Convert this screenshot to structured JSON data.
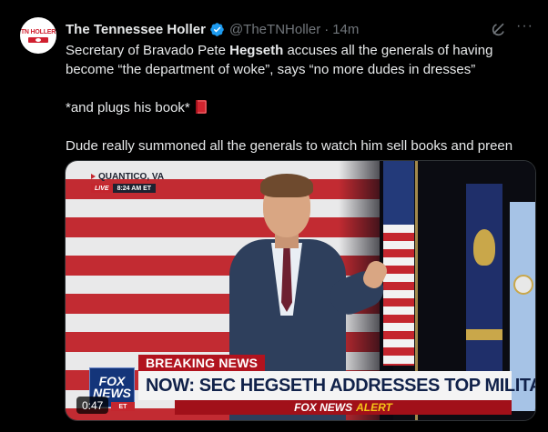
{
  "author": {
    "name": "The Tennessee Holler",
    "handle": "@TheTNHoller",
    "time": "14m",
    "avatar_text": "TN HOLLER",
    "verified_icon": "verified-badge-icon"
  },
  "colors": {
    "background": "#000000",
    "text": "#e7e9ea",
    "muted": "#71767b",
    "verified": "#1d9bf0"
  },
  "tweet": {
    "line1_pre": "Secretary of Bravado Pete ",
    "line1_bold": "Hegseth",
    "line1_post": " accuses all the generals of having become “the department of woke”, says “no more dudes in dresses”",
    "line2": "*and plugs his book*",
    "line2_icon": "red-book-emoji-icon",
    "line3": "Dude really summoned all the generals to watch him sell books and preen"
  },
  "video": {
    "location": "QUANTICO, VA",
    "live": "LIVE",
    "live_time": "8:24 AM ET",
    "breaking": "BREAKING NEWS",
    "headline": "NOW: SEC HEGSETH ADDRESSES TOP MILITARY LEADERS",
    "alert_1": "FOX NEWS",
    "alert_2": "ALERT",
    "logo_line1": "FOX",
    "logo_line2": "NEWS",
    "logo_et": "ET",
    "duration": "0:47"
  }
}
